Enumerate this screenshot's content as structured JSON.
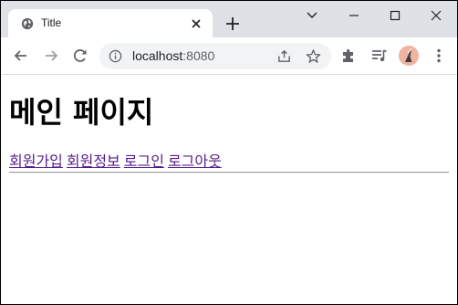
{
  "browser": {
    "tab_title": "Title",
    "address": {
      "host": "localhost",
      "port": ":8080"
    },
    "icons": {
      "tab": "globe-icon",
      "tab_close": "close-icon",
      "new_tab": "plus-icon",
      "dropdown": "chevron-down-icon",
      "minimize": "minimize-icon",
      "maximize": "maximize-icon",
      "close": "window-close-icon",
      "back": "back-arrow-icon",
      "forward": "forward-arrow-icon",
      "reload": "reload-icon",
      "site_info": "info-icon",
      "share": "share-icon",
      "bookmark": "star-icon",
      "extensions": "puzzle-icon",
      "media": "media-list-icon",
      "profile": "avatar",
      "menu": "kebab-menu-icon"
    },
    "colors": {
      "titlebar": "#dee1e6",
      "omnibox": "#f1f3f4",
      "visited_link": "#551a8b"
    }
  },
  "page": {
    "heading": "메인 페이지",
    "links": [
      {
        "label": "회원가입"
      },
      {
        "label": "회원정보"
      },
      {
        "label": "로그인"
      },
      {
        "label": "로그아웃"
      }
    ]
  }
}
